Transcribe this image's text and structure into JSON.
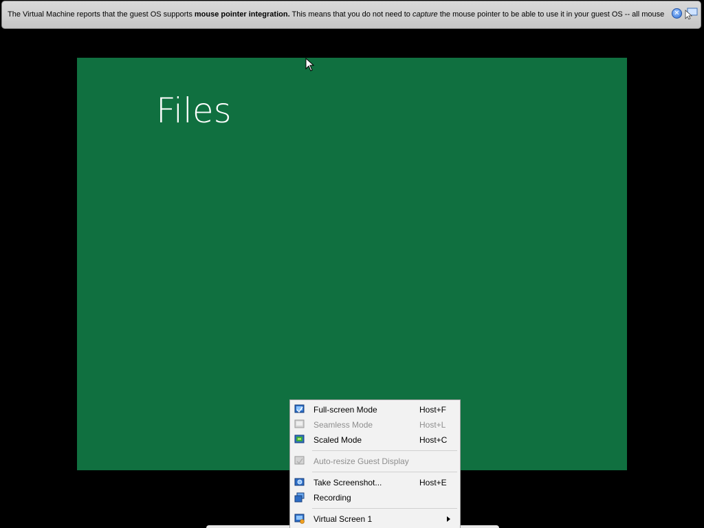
{
  "banner": {
    "text_part1": "The Virtual Machine reports that the guest OS supports ",
    "text_bold": "mouse pointer integration.",
    "text_part2": " This means that you do not need to ",
    "text_italic": "capture",
    "text_part3": " the mouse pointer to be able to use it in your guest OS -- all mouse",
    "close_icon": "close-icon",
    "pointer_icon": "mouse-pointer-integration-icon"
  },
  "guest": {
    "title": "Files",
    "background_color": "#107040"
  },
  "menu": {
    "items": [
      {
        "label": "Full-screen Mode",
        "shortcut": "Host+F",
        "icon": "fullscreen-icon",
        "enabled": true
      },
      {
        "label": "Seamless Mode",
        "shortcut": "Host+L",
        "icon": "seamless-icon",
        "enabled": false
      },
      {
        "label": "Scaled Mode",
        "shortcut": "Host+C",
        "icon": "scaled-icon",
        "enabled": true
      },
      {
        "label": "Auto-resize Guest Display",
        "shortcut": "",
        "icon": "auto-resize-icon",
        "enabled": false
      },
      {
        "label": "Take Screenshot...",
        "shortcut": "Host+E",
        "icon": "screenshot-icon",
        "enabled": true
      },
      {
        "label": "Recording",
        "shortcut": "",
        "icon": "recording-icon",
        "enabled": true
      },
      {
        "label": "Virtual Screen 1",
        "shortcut": "",
        "icon": "virtual-screen-icon",
        "enabled": true,
        "submenu": true
      }
    ]
  }
}
